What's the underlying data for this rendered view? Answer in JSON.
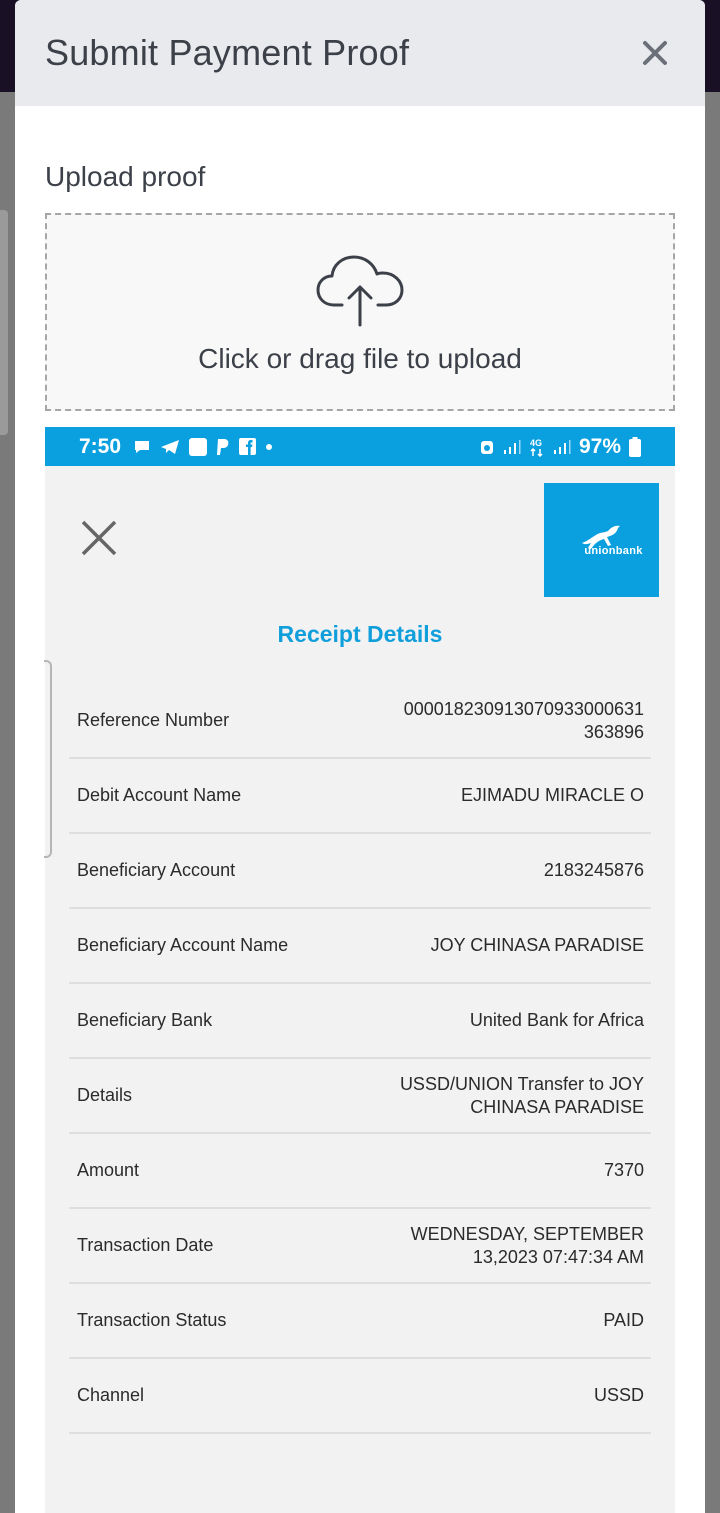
{
  "modal": {
    "title": "Submit Payment Proof",
    "upload_label": "Upload proof",
    "dropzone_text": "Click or drag file to upload",
    "icons": {
      "close": "close-icon",
      "upload": "cloud-upload-icon"
    }
  },
  "screenshot": {
    "status_bar": {
      "time": "7:50",
      "battery": "97%"
    },
    "bank_logo_text": "unionbank",
    "receipt_title": "Receipt Details",
    "rows": [
      {
        "label": "Reference Number",
        "value": "000018230913070933000631\n363896"
      },
      {
        "label": "Debit Account Name",
        "value": "EJIMADU MIRACLE O"
      },
      {
        "label": "Beneficiary Account",
        "value": "2183245876"
      },
      {
        "label": "Beneficiary Account Name",
        "value": "JOY CHINASA PARADISE"
      },
      {
        "label": "Beneficiary Bank",
        "value": "United Bank for Africa"
      },
      {
        "label": "Details",
        "value": "USSD/UNION Transfer to JOY\nCHINASA PARADISE"
      },
      {
        "label": "Amount",
        "value": "7370"
      },
      {
        "label": "Transaction Date",
        "value": "WEDNESDAY, SEPTEMBER\n13,2023 07:47:34 AM"
      },
      {
        "label": "Transaction Status",
        "value": "PAID"
      },
      {
        "label": "Channel",
        "value": "USSD"
      }
    ]
  },
  "colors": {
    "accent": "#0aa0e0",
    "receipt_title": "#119fdb"
  }
}
